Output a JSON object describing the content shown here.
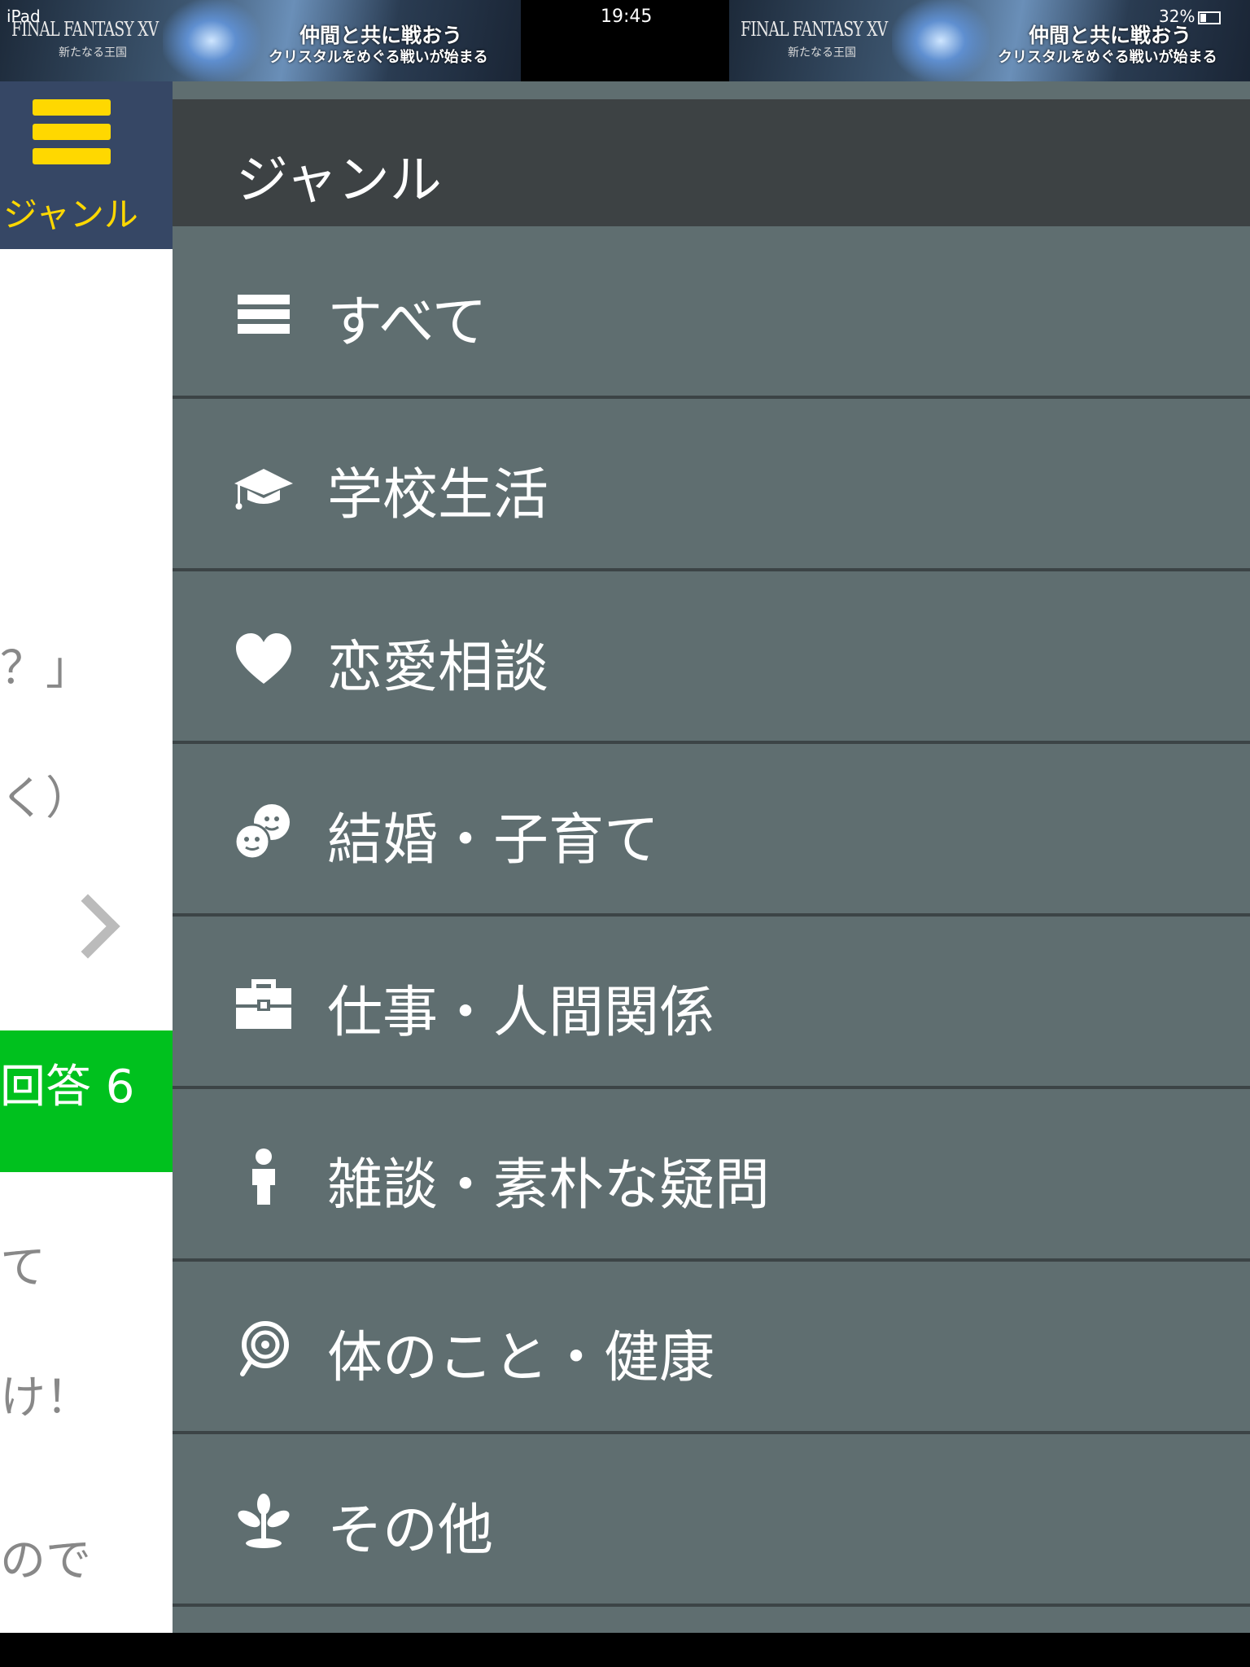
{
  "status_bar": {
    "device": "iPad",
    "time": "19:45",
    "battery": "32%"
  },
  "ads": {
    "logo": "FINAL FANTASY XV",
    "logo_sub": "新たなる王国",
    "copy_line1": "仲間と共に戦おう",
    "copy_line2": "クリスタルをめぐる戦いが始まる"
  },
  "sidebar_button": {
    "label": "ジャンル",
    "icon": "hamburger-icon",
    "color": "#ffd800"
  },
  "background_content": {
    "line1": "？」",
    "line2": "く）",
    "green_label": "回答 6",
    "line3": "て",
    "line4": "け！",
    "line5": "ので"
  },
  "drawer": {
    "title": "ジャンル",
    "items": [
      {
        "label": "すべて",
        "icon": "list-icon"
      },
      {
        "label": "学校生活",
        "icon": "graduation-cap-icon"
      },
      {
        "label": "恋愛相談",
        "icon": "heart-icon"
      },
      {
        "label": "結婚・子育て",
        "icon": "faces-icon"
      },
      {
        "label": "仕事・人間関係",
        "icon": "briefcase-icon"
      },
      {
        "label": "雑談・素朴な疑問",
        "icon": "person-icon"
      },
      {
        "label": "体のこと・健康",
        "icon": "swirl-icon"
      },
      {
        "label": "その他",
        "icon": "sprout-icon"
      }
    ]
  },
  "colors": {
    "drawer_bg": "#5f6e70",
    "header_bg": "#3d4244",
    "accent_yellow": "#ffd800",
    "green": "#00c11e",
    "navy": "#364765"
  }
}
